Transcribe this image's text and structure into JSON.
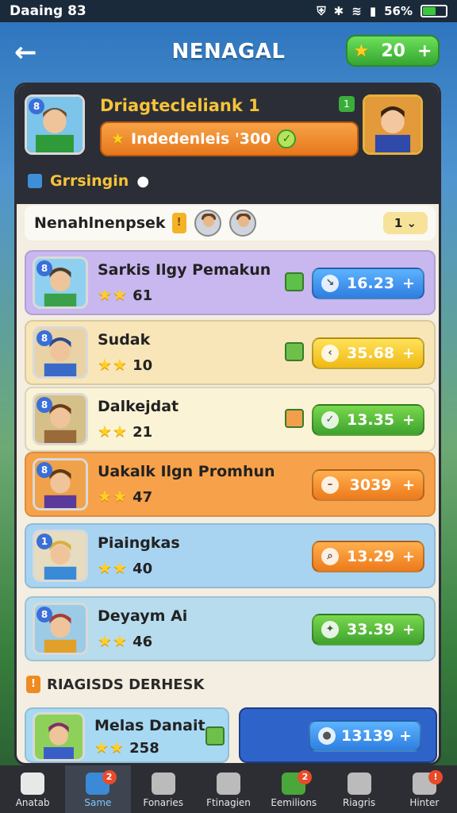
{
  "status_bar": {
    "left_text": "Daaing 83",
    "battery": "56%",
    "battery_level": 0.56
  },
  "header": {
    "title": "NENAGAL",
    "coins": "20",
    "plus": "+"
  },
  "player": {
    "name": "Driagtecleliank 1",
    "bar_text": "Indedenleis '300",
    "group_label": "Grrsingin",
    "badge_left": "8",
    "badge_small": "1"
  },
  "section": {
    "title": "Nenahlnenpsek",
    "badge": "!",
    "pill_text": "1"
  },
  "rows": [
    {
      "name": "Sarkis Ilgy Pemakun",
      "rating": "61",
      "value": "16.23",
      "plus": "+",
      "color": "#c9b7ef",
      "btn": "btn-blue",
      "badge": "8"
    },
    {
      "name": "Sudak",
      "rating": "10",
      "value": "35.68",
      "plus": "+",
      "color": "#f9e6b8",
      "btn": "btn-yellow",
      "badge": "8"
    },
    {
      "name": "Dalkejdat",
      "rating": "21",
      "value": "13.35",
      "plus": "+",
      "color": "#fbf3d6",
      "btn": "btn-green",
      "badge": "8"
    },
    {
      "name": "Uakalk Ilgn Promhun",
      "rating": "47",
      "value": "3039",
      "plus": "+",
      "color": "#f7a24a",
      "btn": "btn-orange",
      "badge": "8"
    },
    {
      "name": "Piaingkas",
      "rating": "40",
      "value": "13.29",
      "plus": "+",
      "color": "#a8d4f2",
      "btn": "btn-orange",
      "badge": "1"
    },
    {
      "name": "Deyaym Ai",
      "rating": "46",
      "value": "33.39",
      "plus": "+",
      "color": "#b7dcee",
      "btn": "btn-green",
      "badge": "8"
    }
  ],
  "recent": {
    "title": "RIAGISDS DERHESK",
    "badge": "!"
  },
  "bottom_card": {
    "name": "Melas Danait",
    "rating": "258",
    "value": "13139",
    "plus": "+"
  },
  "nav": [
    {
      "label": "Anatab",
      "badge": ""
    },
    {
      "label": "Same",
      "badge": "2"
    },
    {
      "label": "Fonaries",
      "badge": ""
    },
    {
      "label": "Ftinagien",
      "badge": ""
    },
    {
      "label": "Eemilions",
      "badge": "2"
    },
    {
      "label": "Riagris",
      "badge": ""
    },
    {
      "label": "Hinter",
      "badge": "!"
    }
  ],
  "colors": {
    "accent_green": "#3ea22d",
    "accent_orange": "#ed7a1b",
    "accent_blue": "#2e7ee0",
    "panel_dark": "#2b2e36"
  }
}
